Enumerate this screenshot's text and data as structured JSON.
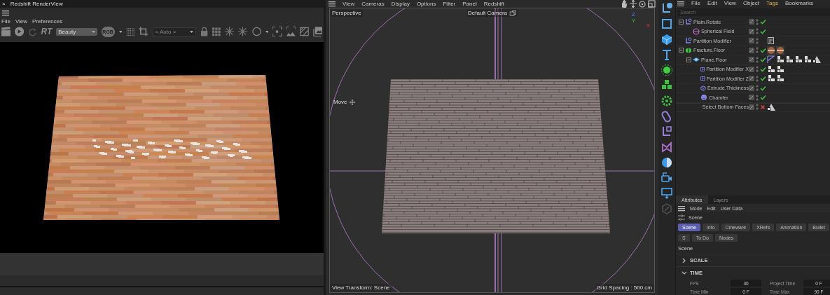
{
  "render_view": {
    "close": "×",
    "title": "Redshift RenderView",
    "menu": [
      "File",
      "View",
      "Preferences"
    ],
    "toolbar": {
      "rt_label": "RT",
      "aov": "Beauty",
      "color_mode": "RGB",
      "region": "< Auto >"
    }
  },
  "viewport": {
    "menu": [
      "View",
      "Cameras",
      "Display",
      "Options",
      "Filter",
      "Panel",
      "Redshift"
    ],
    "view_name": "Perspective",
    "camera": "Default Camera",
    "tool": "Move",
    "axis": {
      "z": "Z",
      "y": "Y",
      "x": "X"
    },
    "view_transform": "View Transform: Scene",
    "grid_spacing": "Grid Spacing : 500 cm"
  },
  "object_manager": {
    "menu": [
      {
        "label": "File",
        "highlighted": false
      },
      {
        "label": "Edit",
        "highlighted": false
      },
      {
        "label": "View",
        "highlighted": false
      },
      {
        "label": "Object",
        "highlighted": false
      },
      {
        "label": "Tags",
        "highlighted": true
      },
      {
        "label": "Bookmarks",
        "highlighted": false
      }
    ],
    "search": {
      "placeholder": "Search"
    },
    "objects": [
      {
        "name": "Plain.Rotate",
        "kind": "effector",
        "expanded": true,
        "enabled": true,
        "children": [
          {
            "name": "Spherical Field",
            "kind": "field",
            "enabled": true
          }
        ]
      },
      {
        "name": "Partition Modifier",
        "kind": "effector",
        "tags": [
          {
            "kind": "note"
          }
        ]
      },
      {
        "name": "Fracture.Floor",
        "kind": "fracture",
        "expanded": true,
        "enabled": true,
        "tags": [
          {
            "kind": "material"
          },
          {
            "kind": "material"
          }
        ],
        "children": [
          {
            "name": "Plane.Floor",
            "kind": "plane",
            "expanded": true,
            "enabled": true,
            "tags": [
              {
                "kind": "phong"
              },
              {
                "kind": "selection"
              },
              {
                "kind": "selection"
              },
              {
                "kind": "selection"
              },
              {
                "kind": "selection"
              },
              {
                "kind": "restriction"
              }
            ],
            "children": [
              {
                "name": "Partition Modifier X",
                "kind": "partition",
                "enabled": true,
                "tags": [
                  {
                    "kind": "selection"
                  },
                  {
                    "kind": "selection"
                  }
                ]
              },
              {
                "name": "Partition Modifier Z",
                "kind": "partition",
                "enabled": true,
                "tags": [
                  {
                    "kind": "selection"
                  },
                  {
                    "kind": "selection"
                  }
                ]
              },
              {
                "name": "Extrude.Thickness",
                "kind": "extrude",
                "enabled": true
              },
              {
                "name": "Chamfer",
                "kind": "chamfer",
                "enabled": true
              },
              {
                "name": "Select Bottom Faces",
                "kind": "select",
                "enabled": false,
                "tags": [
                  {
                    "kind": "restriction"
                  }
                ]
              }
            ]
          }
        ]
      }
    ]
  },
  "attributes": {
    "tabs": [
      {
        "label": "Attributes",
        "selected": true
      },
      {
        "label": "Layers",
        "selected": false
      }
    ],
    "menu": [
      "Mode",
      "Edit",
      "User Data"
    ],
    "context": "Scene",
    "buttons": [
      {
        "label": "Scene",
        "selected": true
      },
      {
        "label": "Info",
        "selected": false
      },
      {
        "label": "Cineware",
        "selected": false
      },
      {
        "label": "XRefs",
        "selected": false
      },
      {
        "label": "Animation",
        "selected": false
      },
      {
        "label": "Bullet",
        "selected": false
      },
      {
        "label": "S",
        "selected": false
      },
      {
        "label": "To Do",
        "selected": false
      },
      {
        "label": "Nodes",
        "selected": false
      }
    ],
    "section_title": "Scene",
    "groups": [
      {
        "title": "SCALE",
        "expanded": false
      },
      {
        "title": "TIME",
        "expanded": true,
        "fields": [
          {
            "label": "FPS",
            "value": "30"
          },
          {
            "label": "Project Time",
            "value": "0 F"
          },
          {
            "label": "Time Min",
            "value": "0 F"
          },
          {
            "label": "Time Max",
            "value": "90 F"
          }
        ]
      }
    ]
  }
}
